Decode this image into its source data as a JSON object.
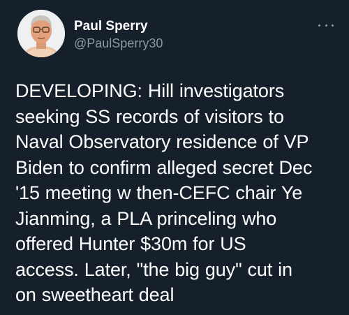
{
  "tweet": {
    "display_name": "Paul Sperry",
    "handle": "@PaulSperry30",
    "more_icon": "more-horizontal-icon",
    "avatar_icon": "profile-photo",
    "text_lines": [
      "DEVELOPING: Hill investigators",
      "seeking SS records of visitors to",
      "Naval Observatory residence of VP",
      "Biden to confirm alleged secret Dec",
      "'15 meeting w then-CEFC chair Ye",
      "Jianming, a PLA princeling who",
      "offered Hunter $30m for US",
      "access. Later, \"the big guy\" cut in",
      "on sweetheart deal"
    ]
  },
  "colors": {
    "background": "#15202b",
    "primary_text": "#ffffff",
    "secondary_text": "#8b98a5"
  }
}
